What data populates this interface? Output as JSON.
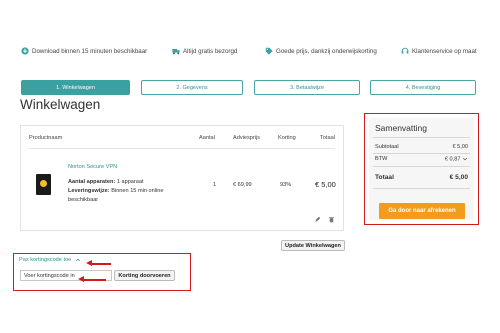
{
  "features": [
    {
      "icon": "download-icon",
      "text": "Download binnen 15 minuten beschikbaar"
    },
    {
      "icon": "truck-icon",
      "text": "Altijd gratis bezorgd"
    },
    {
      "icon": "tag-icon",
      "text": "Goede prijs, dankzij onderwijskorting"
    },
    {
      "icon": "headset-icon",
      "text": "Klantenservice op maat"
    }
  ],
  "steps": [
    {
      "label": "1. Winkelwagen",
      "active": true
    },
    {
      "label": "2. Gegevens",
      "active": false
    },
    {
      "label": "3. Betaalwijze",
      "active": false
    },
    {
      "label": "4. Bevestiging",
      "active": false
    }
  ],
  "page_title": "Winkelwagen",
  "cart": {
    "headers": {
      "product": "Productnaam",
      "qty": "Aantal",
      "price": "Adviesprijs",
      "discount": "Korting",
      "total": "Totaal"
    },
    "item": {
      "name": "Norton Secure VPN",
      "devices_label": "Aantal apparaten:",
      "devices_value": "1 apparaat",
      "delivery_label": "Leveringswijze:",
      "delivery_value_1": "Binnen 15 min online",
      "delivery_value_2": "beschikbaar",
      "qty": "1",
      "price": "€ 69,99",
      "discount": "93%",
      "total": "€ 5,00"
    },
    "update_button": "Update Winkelwagen"
  },
  "summary": {
    "title": "Samenvatting",
    "subtotal_label": "Subtotaal",
    "subtotal_value": "€ 5,00",
    "vat_label": "BTW",
    "vat_value": "€ 0,87",
    "total_label": "Totaal",
    "total_value": "€ 5,00",
    "checkout_button": "Ga door naar afrekenen"
  },
  "discount": {
    "toggle_label": "Pas kortingscode toe",
    "input_value": "Voer kortingscode in",
    "apply_button": "Korting doorvoeren"
  },
  "colors": {
    "accent": "#3aa0a0",
    "checkout": "#f39c1b",
    "highlight": "#d51a1a"
  }
}
